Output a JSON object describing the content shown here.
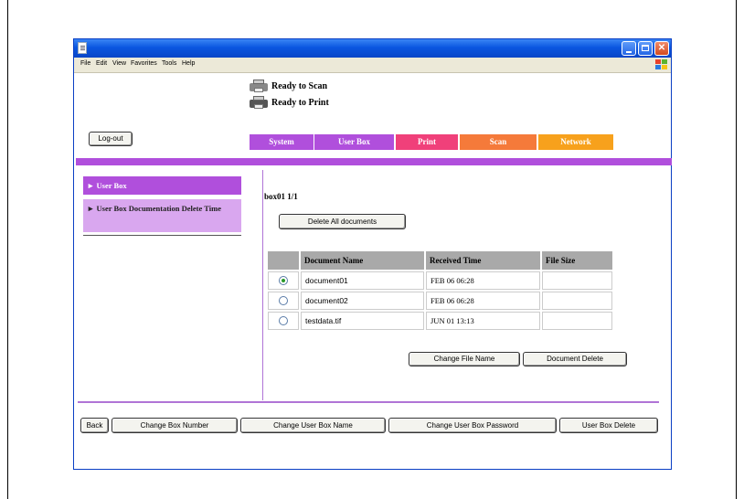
{
  "menu": [
    "File",
    "Edit",
    "View",
    "Favorites",
    "Tools",
    "Help"
  ],
  "status": {
    "scan": "Ready to Scan",
    "print": "Ready to Print"
  },
  "logout_label": "Log-out",
  "tabs": [
    {
      "label": "System",
      "color": "#b04fdc"
    },
    {
      "label": "User Box",
      "color": "#b04fdc"
    },
    {
      "label": "Print",
      "color": "#f0407a"
    },
    {
      "label": "Scan",
      "color": "#f57a3a"
    },
    {
      "label": "Network",
      "color": "#f7a11c"
    }
  ],
  "sidebar": {
    "items": [
      {
        "label": "► User Box"
      },
      {
        "label": "► User Box Documentation Delete Time"
      }
    ]
  },
  "box": {
    "label": "box01  1/1"
  },
  "delete_all_label": "Delete All documents",
  "table": {
    "headers": [
      "Document Name",
      "Received Time",
      "File Size"
    ],
    "rows": [
      {
        "selected": true,
        "name": "document01",
        "time": "FEB 06 06:28",
        "size": ""
      },
      {
        "selected": false,
        "name": "document02",
        "time": "FEB 06 06:28",
        "size": ""
      },
      {
        "selected": false,
        "name": "testdata.tif",
        "time": "JUN 01 13:13",
        "size": ""
      }
    ]
  },
  "doc_actions": {
    "change_name": "Change File Name",
    "delete": "Document Delete"
  },
  "bottom_buttons": {
    "back": "Back",
    "change_number": "Change Box Number",
    "change_name": "Change User Box Name",
    "change_password": "Change User Box Password",
    "delete": "User Box Delete"
  }
}
